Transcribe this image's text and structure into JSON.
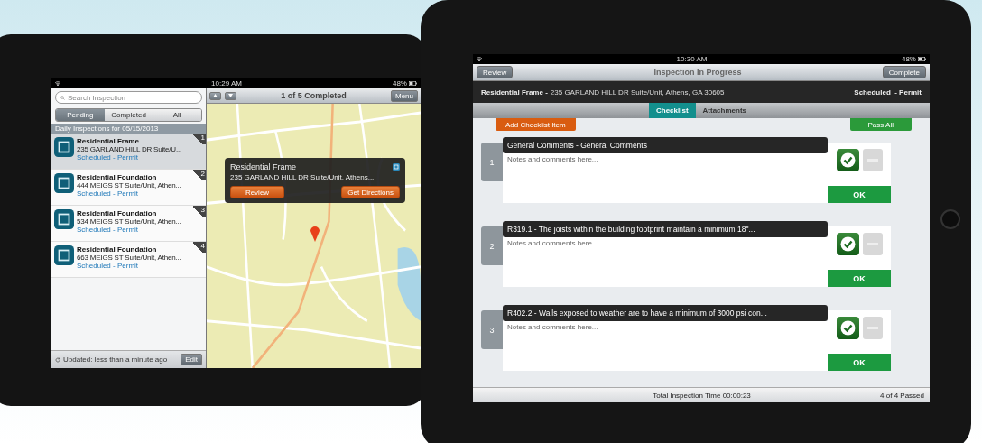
{
  "left_device": {
    "status_bar": {
      "time": "10:29 AM",
      "battery": "48%"
    },
    "sidebar": {
      "search": {
        "placeholder": "Search Inspection"
      },
      "segments": [
        {
          "label": "Pending",
          "selected": true
        },
        {
          "label": "Completed",
          "selected": false
        },
        {
          "label": "All",
          "selected": false
        }
      ],
      "section_title": "Daily Inspections for 05/15/2013",
      "items": [
        {
          "number": "1",
          "title": "Residential Frame",
          "address": "235 GARLAND HILL DR Suite/U...",
          "status": "Scheduled",
          "type": "- Permit",
          "selected": true
        },
        {
          "number": "2",
          "title": "Residential Foundation",
          "address": "444 MEIGS ST Suite/Unit, Athen...",
          "status": "Scheduled",
          "type": "- Permit",
          "selected": false
        },
        {
          "number": "3",
          "title": "Residential Foundation",
          "address": "534 MEIGS ST Suite/Unit, Athen...",
          "status": "Scheduled",
          "type": "- Permit",
          "selected": false
        },
        {
          "number": "4",
          "title": "Residential Foundation",
          "address": "663 MEIGS ST Suite/Unit, Athen...",
          "status": "Scheduled",
          "type": "- Permit",
          "selected": false
        }
      ],
      "footer": {
        "updated": "Updated: less than a minute ago",
        "edit_button": "Edit"
      }
    },
    "map": {
      "toolbar": {
        "title": "1 of 5 Completed",
        "menu_button": "Menu"
      },
      "popup": {
        "title": "Residential Frame",
        "address": "235 GARLAND HILL DR Suite/Unit, Athens...",
        "buttons": [
          "Review",
          "Get Directions"
        ]
      }
    }
  },
  "right_device": {
    "status_bar": {
      "time": "10:30 AM",
      "battery": "48%"
    },
    "nav": {
      "back_button": "Review",
      "title": "Inspection In Progress",
      "action_button": "Complete"
    },
    "info": {
      "title": "Residential Frame -",
      "address": "235 GARLAND HILL DR Suite/Unit, Athens, GA 30605",
      "status": "Scheduled  - Permit"
    },
    "tabs": [
      {
        "label": "Checklist",
        "selected": true
      },
      {
        "label": "Attachments",
        "selected": false
      }
    ],
    "add_button": "Add Checklist Item",
    "pass_all_button": "Pass All",
    "items": [
      {
        "number": "1",
        "title": "General Comments - General Comments",
        "placeholder": "Notes and comments here...",
        "result": "OK",
        "passed": true
      },
      {
        "number": "2",
        "title": "R319.1 - The joists within the building footprint maintain a minimum 18\"...",
        "placeholder": "Notes and comments here...",
        "result": "OK",
        "passed": true
      },
      {
        "number": "3",
        "title": "R402.2 - Walls exposed to weather are to have a minimum of 3000 psi con...",
        "placeholder": "Notes and comments here...",
        "result": "OK",
        "passed": true
      }
    ],
    "footer": {
      "time": "Total Inspection Time 00:00:23",
      "summary": "4 of 4 Passed"
    }
  }
}
